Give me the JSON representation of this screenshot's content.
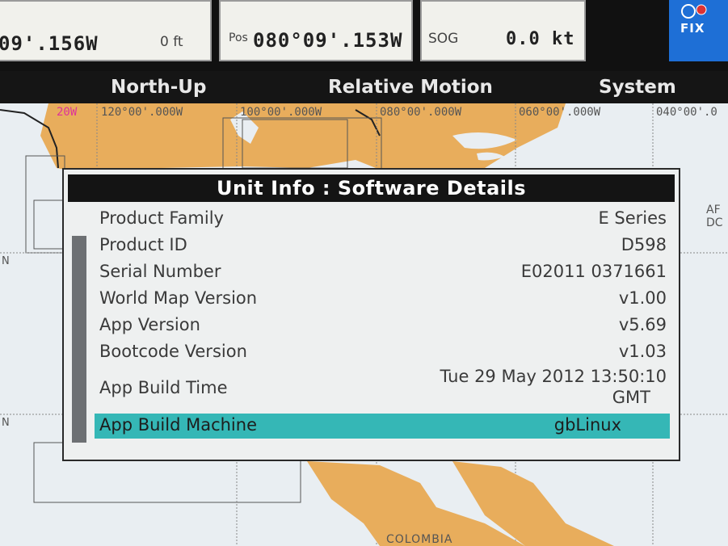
{
  "top_bar": {
    "box1": {
      "value": "09'.156W",
      "depth": "0 ft"
    },
    "box2": {
      "label": "Pos",
      "value": "080°09'.153W"
    },
    "box3": {
      "label": "SOG",
      "value": "0.0 kt"
    },
    "fix_label": "FIX"
  },
  "menu": {
    "items": [
      "North-Up",
      "Relative Motion",
      "System"
    ]
  },
  "map": {
    "longitudes": [
      "20W",
      "120°00'.000W",
      "100°00'.000W",
      "080°00'.000W",
      "060°00'.000W",
      "040°00'.0"
    ],
    "side_labels": [
      "N",
      "N",
      "AF DC"
    ],
    "country_label": "COLOMBIA"
  },
  "dialog": {
    "title": "Unit Info : Software Details",
    "rows": [
      {
        "key": "Product Family",
        "value": "E Series"
      },
      {
        "key": "Product ID",
        "value": "D598"
      },
      {
        "key": "Serial Number",
        "value": "E02011 0371661"
      },
      {
        "key": "World Map Version",
        "value": "v1.00"
      },
      {
        "key": "App Version",
        "value": "v5.69"
      },
      {
        "key": "Bootcode Version",
        "value": "v1.03"
      },
      {
        "key": "App Build Time",
        "value": "Tue 29 May 2012 13:50:10",
        "value2": "GMT"
      },
      {
        "key": "App Build Machine",
        "value": "gbLinux"
      }
    ]
  },
  "colors": {
    "highlight": "#35b7b6",
    "land": "#e8ad5c",
    "fix_bg": "#1e6fd6",
    "menu_bg": "#151515"
  }
}
